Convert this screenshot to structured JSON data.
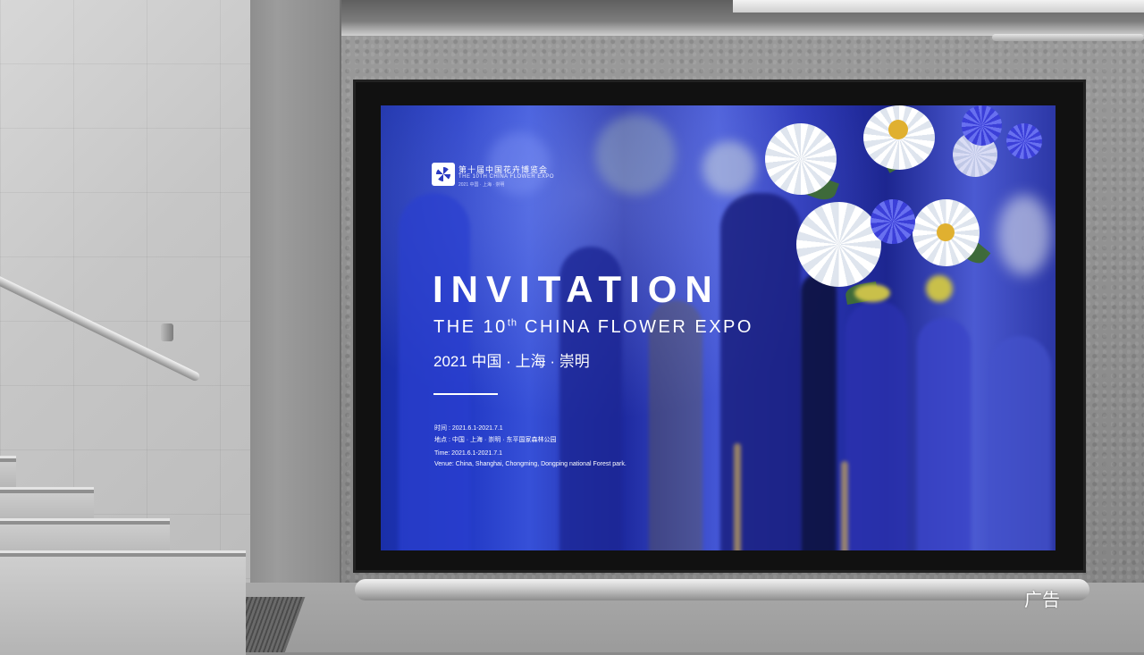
{
  "poster": {
    "logo": {
      "name_cn": "第十届中国花卉博览会",
      "name_en": "THE 10TH CHINA FLOWER EXPO",
      "sub": "2021 中国 · 上海 · 崇明"
    },
    "title": "INVITATION",
    "subtitle_pre": "THE 10",
    "subtitle_sup": "th",
    "subtitle_post": " CHINA FLOWER EXPO",
    "dateline": "2021 中国 · 上海 · 崇明",
    "info": {
      "time_cn": "时间 : 2021.6.1-2021.7.1",
      "venue_cn": "地点 : 中国 · 上海 · 崇明 · 东平国家森林公园",
      "time_en": "Time: 2021.6.1-2021.7.1",
      "venue_en": "Venue: China, Shanghai, Chongming, Dongping national Forest park."
    }
  },
  "ad_label": "广告",
  "colors": {
    "poster_blue": "#2138c4",
    "text_white": "#ffffff",
    "frame_black": "#111111"
  }
}
